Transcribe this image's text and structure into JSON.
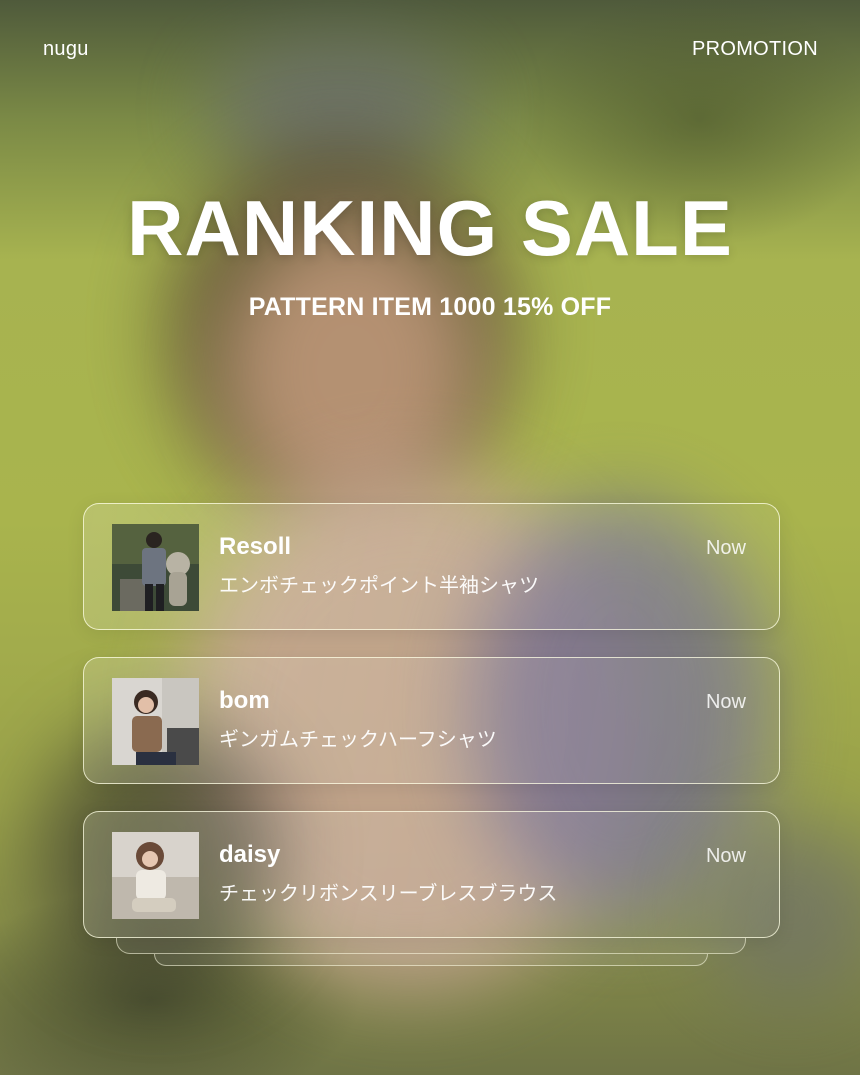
{
  "header": {
    "brand": "nugu",
    "section": "PROMOTION"
  },
  "hero": {
    "title": "RANKING SALE",
    "subtitle": "PATTERN ITEM 1000 15% OFF"
  },
  "notifications": [
    {
      "name": "Resoll",
      "item": "エンボチェックポイント半袖シャツ",
      "time": "Now",
      "thumb_icon": "photo-thumbnail-icon"
    },
    {
      "name": "bom",
      "item": "ギンガムチェックハーフシャツ",
      "time": "Now",
      "thumb_icon": "photo-thumbnail-icon"
    },
    {
      "name": "daisy",
      "item": "チェックリボンスリーブレスブラウス",
      "time": "Now",
      "thumb_icon": "photo-thumbnail-icon"
    }
  ],
  "colors": {
    "background": "#a9b44d",
    "text": "#ffffff"
  }
}
